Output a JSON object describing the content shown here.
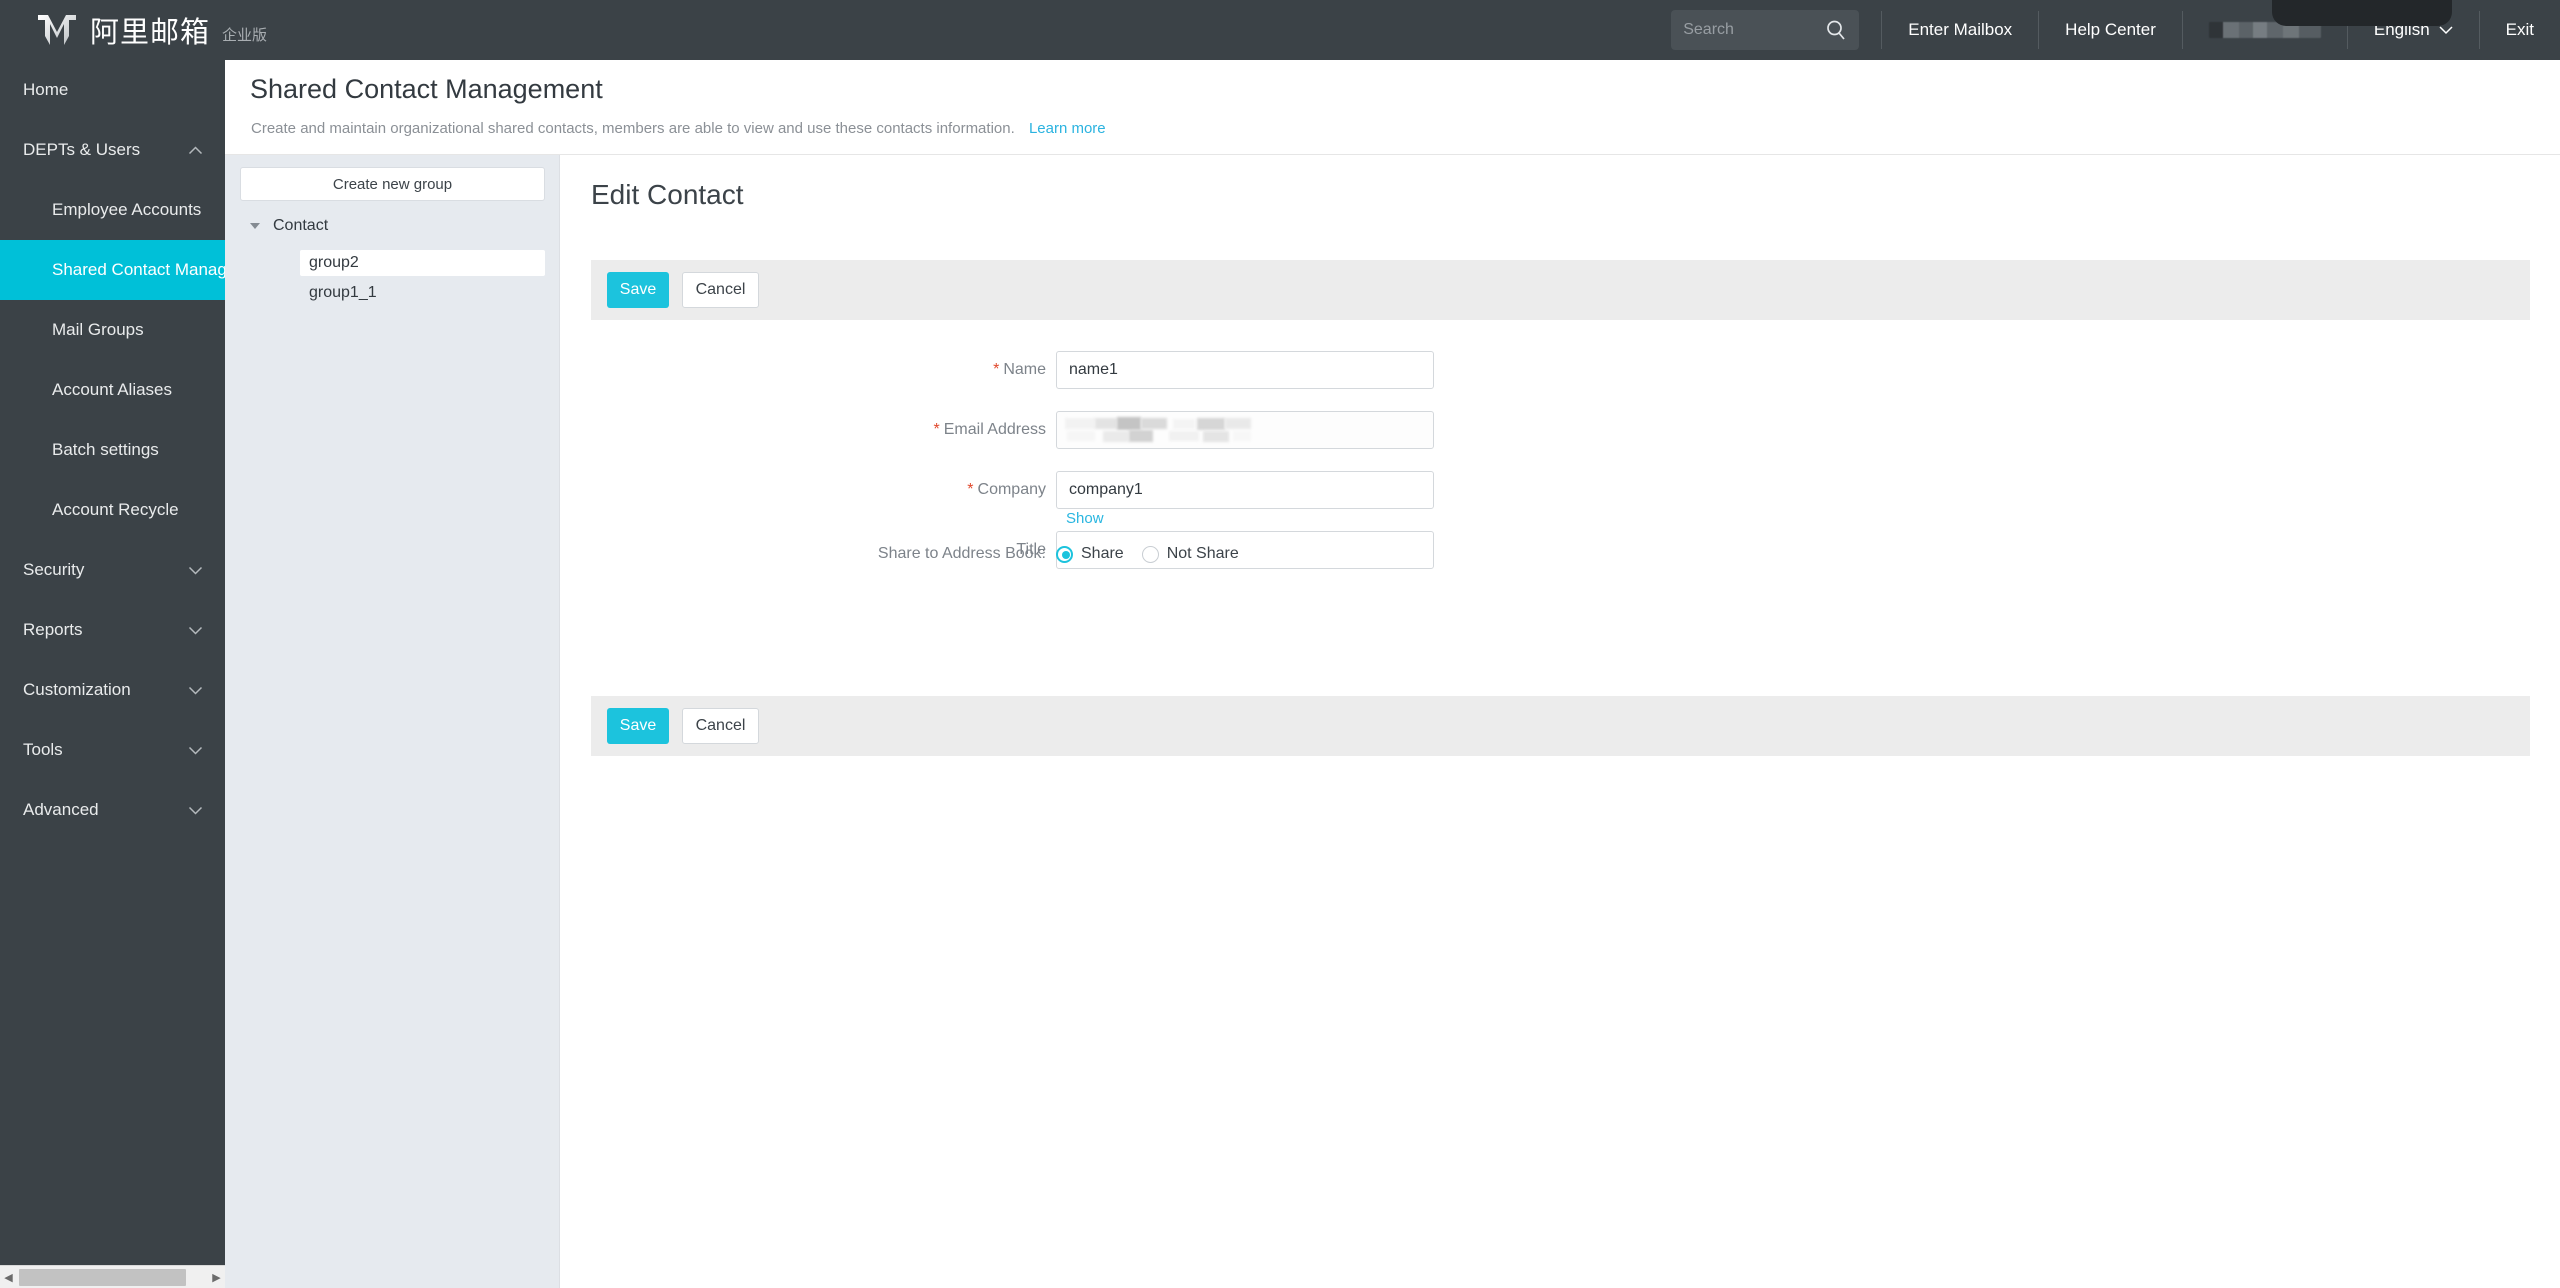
{
  "header": {
    "brand_cn": "阿里邮箱",
    "brand_sub": "企业版",
    "logo_icon": "m-logo-icon",
    "search": {
      "placeholder": "Search",
      "value": "",
      "icon": "search-icon"
    },
    "links": [
      {
        "label": "Enter Mailbox",
        "name": "enter-mailbox-link"
      },
      {
        "label": "Help Center",
        "name": "help-center-link"
      }
    ],
    "username_masked": "",
    "language": {
      "label": "English",
      "icon": "chevron-down-icon"
    },
    "exit": {
      "label": "Exit"
    }
  },
  "sidebar": {
    "items": [
      {
        "label": "Home",
        "level": "top",
        "chevron": "",
        "active": false
      },
      {
        "label": "DEPTs & Users",
        "level": "top",
        "chevron": "chevron-up-icon",
        "active": false
      },
      {
        "label": "Employee Accounts",
        "level": "sub",
        "chevron": "",
        "active": false
      },
      {
        "label": "Shared Contact Management",
        "level": "sub",
        "chevron": "",
        "active": true
      },
      {
        "label": "Mail Groups",
        "level": "sub",
        "chevron": "",
        "active": false
      },
      {
        "label": "Account Aliases",
        "level": "sub",
        "chevron": "",
        "active": false
      },
      {
        "label": "Batch settings",
        "level": "sub",
        "chevron": "",
        "active": false
      },
      {
        "label": "Account Recycle",
        "level": "sub",
        "chevron": "",
        "active": false
      },
      {
        "label": "Security",
        "level": "top",
        "chevron": "chevron-down-icon",
        "active": false
      },
      {
        "label": "Reports",
        "level": "top",
        "chevron": "chevron-down-icon",
        "active": false
      },
      {
        "label": "Customization",
        "level": "top",
        "chevron": "chevron-down-icon",
        "active": false
      },
      {
        "label": "Tools",
        "level": "top",
        "chevron": "chevron-down-icon",
        "active": false
      },
      {
        "label": "Advanced",
        "level": "top",
        "chevron": "chevron-down-icon",
        "active": false
      }
    ],
    "scrollbar": {
      "left_arrow": "◀",
      "right_arrow": "▶"
    }
  },
  "page": {
    "title": "Shared Contact Management",
    "description": "Create and maintain organizational shared contacts, members are able to view and use these contacts information.",
    "learn_more": "Learn more"
  },
  "group_panel": {
    "create_button": "Create new group",
    "root": {
      "label": "Contact",
      "expanded": true,
      "icon": "triangle-down-icon"
    },
    "children": [
      {
        "label": "group2",
        "selected": true
      },
      {
        "label": "group1_1",
        "selected": false
      }
    ]
  },
  "main": {
    "title": "Edit Contact",
    "toolbar": {
      "save_label": "Save",
      "cancel_label": "Cancel"
    },
    "fields": [
      {
        "label": "Name",
        "required": true,
        "value": "name1",
        "masked": false
      },
      {
        "label": "Email Address",
        "required": true,
        "value": "",
        "masked": true
      },
      {
        "label": "Company",
        "required": true,
        "value": "company1",
        "masked": false
      },
      {
        "label": "Title",
        "required": false,
        "value": "",
        "masked": false
      }
    ],
    "show_link": "Show",
    "share": {
      "label": "Share to Address Book:",
      "options": [
        {
          "label": "Share",
          "selected": true
        },
        {
          "label": "Not Share",
          "selected": false
        }
      ]
    }
  },
  "colors": {
    "accent": "#1cc3dd",
    "sidebar_bg": "#3b4247",
    "active_nav": "#00c0d8",
    "link": "#29b6e0",
    "required": "#e0482c",
    "panel_bg": "#e6eaef"
  }
}
